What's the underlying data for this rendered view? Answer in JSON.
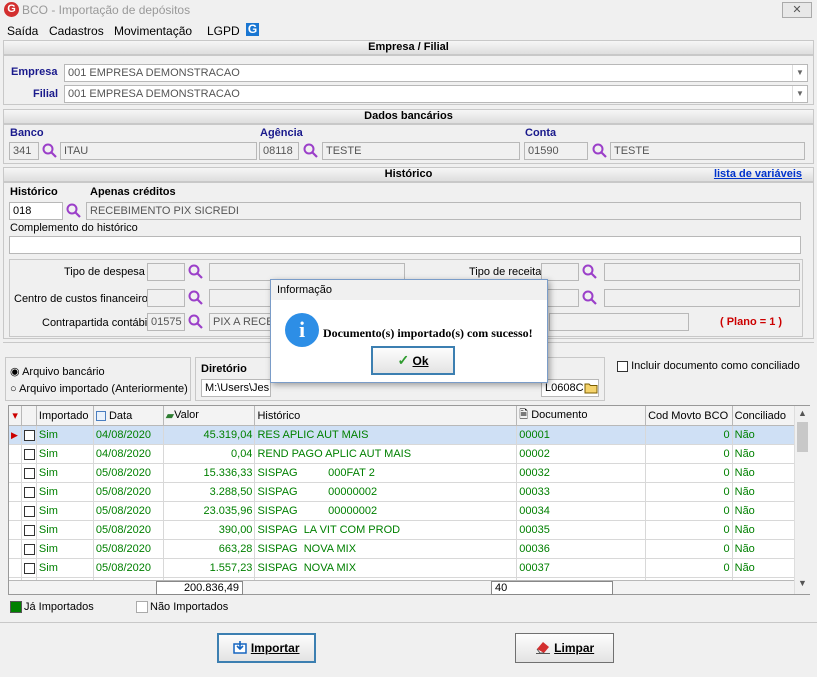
{
  "window": {
    "title": "BCO - Importação de depósitos",
    "app_icon": "G",
    "close": "✕"
  },
  "menu": {
    "items": [
      "Saída",
      "Cadastros",
      "Movimentação",
      "LGPD"
    ],
    "g_icon": "G"
  },
  "empresa_section": {
    "title": "Empresa / Filial",
    "empresa_label": "Empresa",
    "empresa_value": "001 EMPRESA DEMONSTRACAO",
    "filial_label": "Filial",
    "filial_value": "001 EMPRESA DEMONSTRACAO"
  },
  "banco_section": {
    "title": "Dados bancários",
    "banco_label": "Banco",
    "banco_code": "341",
    "banco_name": "ITAU",
    "agencia_label": "Agência",
    "agencia_code": "08118",
    "agencia_name": "TESTE",
    "conta_label": "Conta",
    "conta_code": "01590",
    "conta_name": "TESTE"
  },
  "historico_section": {
    "title": "Histórico",
    "link": "lista de variáveis",
    "historico_label": "Histórico",
    "historico_code": "018",
    "apenas_label": "Apenas créditos",
    "apenas_value": "RECEBIMENTO PIX SICREDI",
    "complemento_label": "Complemento do histórico",
    "complemento_value": "",
    "tipo_despesa_label": "Tipo de despesa",
    "centro_custos_label": "Centro de custos financeiro",
    "contrapartida_label": "Contrapartida contábil",
    "contrapartida_code": "01575",
    "contrapartida_name": "PIX A RECE",
    "tipo_receita_label": "Tipo de receita",
    "plano_text": "( Plano = 1 )"
  },
  "import_options": {
    "radio_arquivo_bancario": "Arquivo bancário",
    "radio_arquivo_importado": "Arquivo importado (Anteriormente)",
    "diretorio_label": "Diretório",
    "diretorio_value": "M:\\Users\\Jes",
    "diretorio_tail": "L0608C",
    "incluir_label": "Incluir documento como conciliado"
  },
  "grid": {
    "headers": [
      "Importado",
      "Data",
      "Valor",
      "Histórico",
      "Documento",
      "Cod Movto BCO",
      "Conciliado"
    ],
    "rows": [
      {
        "importado": "Sim",
        "data": "04/08/2020",
        "valor": "45.319,04",
        "historico": "RES APLIC AUT MAIS",
        "documento": "00001",
        "cod": "0",
        "conciliado": "Não"
      },
      {
        "importado": "Sim",
        "data": "04/08/2020",
        "valor": "0,04",
        "historico": "REND PAGO APLIC AUT MAIS",
        "documento": "00002",
        "cod": "0",
        "conciliado": "Não"
      },
      {
        "importado": "Sim",
        "data": "05/08/2020",
        "valor": "15.336,33",
        "historico": "SISPAG          000FAT 2",
        "documento": "00032",
        "cod": "0",
        "conciliado": "Não"
      },
      {
        "importado": "Sim",
        "data": "05/08/2020",
        "valor": "3.288,50",
        "historico": "SISPAG          00000002",
        "documento": "00033",
        "cod": "0",
        "conciliado": "Não"
      },
      {
        "importado": "Sim",
        "data": "05/08/2020",
        "valor": "23.035,96",
        "historico": "SISPAG          00000002",
        "documento": "00034",
        "cod": "0",
        "conciliado": "Não"
      },
      {
        "importado": "Sim",
        "data": "05/08/2020",
        "valor": "390,00",
        "historico": "SISPAG  LA VIT COM PROD",
        "documento": "00035",
        "cod": "0",
        "conciliado": "Não"
      },
      {
        "importado": "Sim",
        "data": "05/08/2020",
        "valor": "663,28",
        "historico": "SISPAG  NOVA MIX",
        "documento": "00036",
        "cod": "0",
        "conciliado": "Não"
      },
      {
        "importado": "Sim",
        "data": "05/08/2020",
        "valor": "1.557,23",
        "historico": "SISPAG  NOVA MIX",
        "documento": "00037",
        "cod": "0",
        "conciliado": "Não"
      }
    ],
    "total_valor": "200.836,49",
    "total_documento": "40"
  },
  "legend": {
    "ja_importados": "Já Importados",
    "nao_importados": "Não Importados",
    "green": "#008000"
  },
  "buttons": {
    "importar": "Importar",
    "limpar": "Limpar"
  },
  "dialog": {
    "title": "Informação",
    "message": "Documento(s) importado(s) com sucesso!",
    "ok": "Ok",
    "icon": "i"
  }
}
